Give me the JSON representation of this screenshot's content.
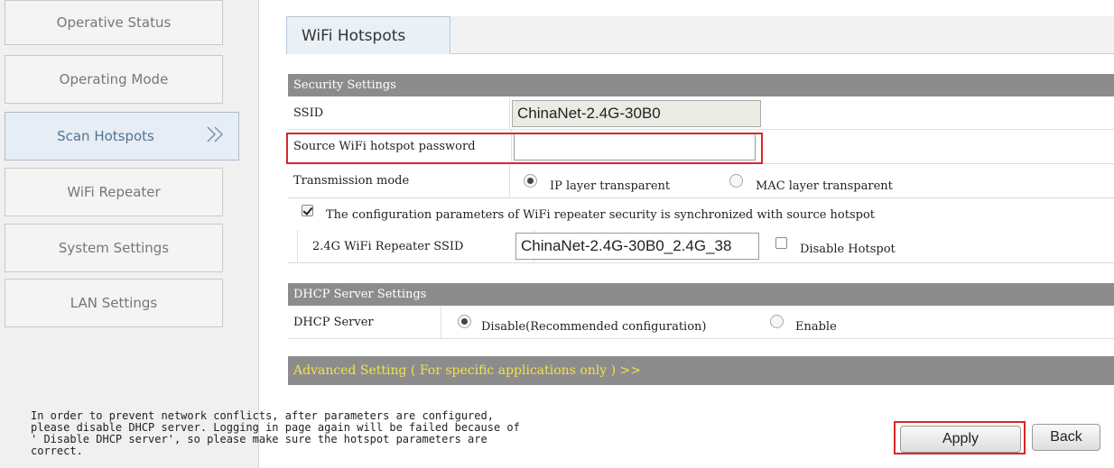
{
  "sidebar": {
    "items": [
      {
        "label": "Operative Status"
      },
      {
        "label": "Operating Mode"
      },
      {
        "label": "Scan Hotspots"
      },
      {
        "label": "WiFi Repeater"
      },
      {
        "label": "System Settings"
      },
      {
        "label": "LAN Settings"
      }
    ],
    "active_index": 2
  },
  "tab": {
    "label": "WiFi Hotspots"
  },
  "security": {
    "title": "Security Settings",
    "ssid_label": "SSID",
    "ssid_value": "ChinaNet-2.4G-30B0",
    "password_label": "Source WiFi hotspot password",
    "password_value": "",
    "transmission_label": "Transmission mode",
    "mode_ip": "IP layer transparent",
    "mode_mac": "MAC layer transparent",
    "mode_selected": "IP layer transparent",
    "sync_label": "The configuration parameters of WiFi repeater security is synchronized with source hotspot",
    "sync_checked": true,
    "repeater_ssid_label": "2.4G WiFi Repeater SSID",
    "repeater_ssid_value": "ChinaNet-2.4G-30B0_2.4G_38",
    "disable_hotspot_label": "Disable Hotspot",
    "disable_hotspot_checked": false
  },
  "dhcp": {
    "title": "DHCP Server Settings",
    "label": "DHCP Server",
    "option_disable": "Disable(Recommended configuration)",
    "option_enable": "Enable",
    "selected": "Disable(Recommended configuration)"
  },
  "advanced": {
    "label": "Advanced Setting ( For specific applications only ) >>"
  },
  "note": {
    "text": "In order to prevent network conflicts, after parameters are configured,\nplease disable DHCP server. Logging in page again will be failed because of\n' Disable DHCP server', so please make sure the hotspot parameters are\ncorrect."
  },
  "buttons": {
    "apply": "Apply",
    "back": "Back"
  },
  "colors": {
    "highlight": "#d9262a",
    "section_bar": "#8c8c8c",
    "advanced_text": "#f2e24a"
  }
}
